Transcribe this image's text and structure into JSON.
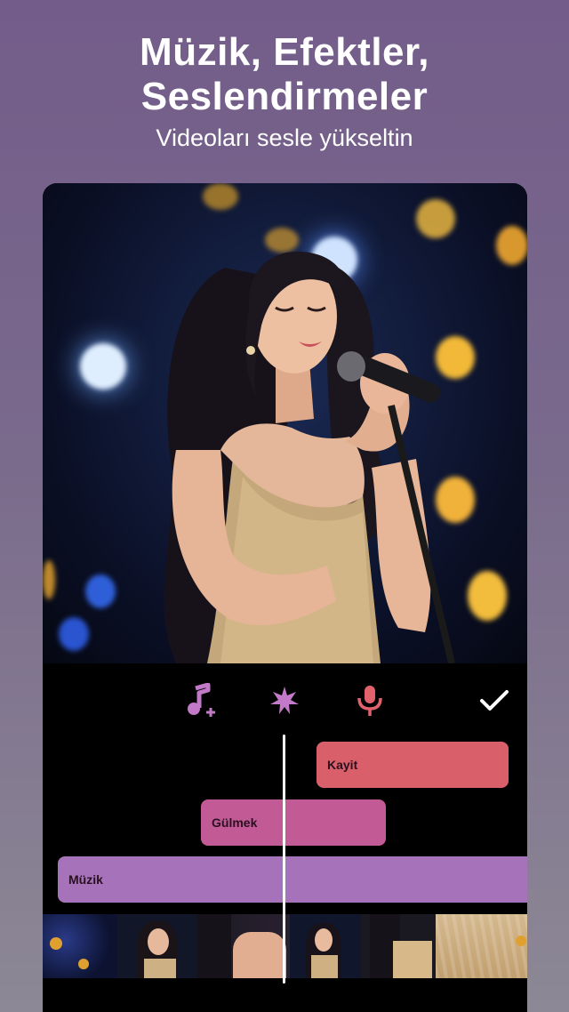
{
  "header": {
    "title_line1": "Müzik, Efektler,",
    "title_line2": "Seslendirmeler",
    "subtitle": "Videoları sesle yükseltin"
  },
  "toolbar": {
    "add_music_icon": "music-add-icon",
    "effects_icon": "effects-star-icon",
    "record_icon": "microphone-icon",
    "confirm_icon": "checkmark-icon"
  },
  "tracks": {
    "record_label": "Kayit",
    "laugh_label": "Gülmek",
    "music_label": "Müzik"
  },
  "colors": {
    "background_top": "#735c8a",
    "record_track": "#d9606a",
    "laugh_track": "#c25a96",
    "music_track": "#a673bb",
    "tool_icon": "#c27ac8",
    "mic_icon": "#e0626c"
  }
}
